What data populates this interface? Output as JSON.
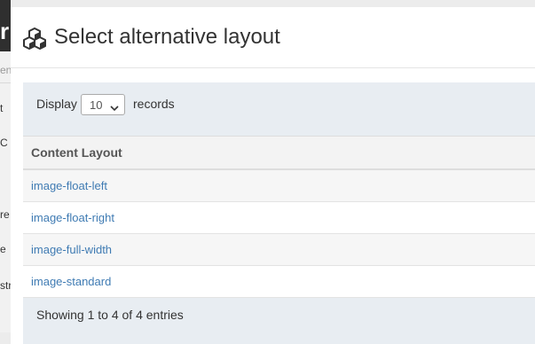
{
  "background": {
    "header_fragment": "r",
    "fragments": [
      "en",
      "t",
      "C",
      "re",
      "e",
      "str"
    ]
  },
  "modal": {
    "icon": "cubes-icon",
    "title": "Select alternative layout",
    "length_menu": {
      "prefix": "Display",
      "selected": "10",
      "suffix": "records"
    },
    "table": {
      "columns": [
        "Content Layout"
      ],
      "rows": [
        "image-float-left",
        "image-float-right",
        "image-full-width",
        "image-standard"
      ]
    },
    "info": "Showing 1 to 4 of 4 entries"
  },
  "colors": {
    "link": "#3f7bb3",
    "panel": "#e8edf2"
  }
}
